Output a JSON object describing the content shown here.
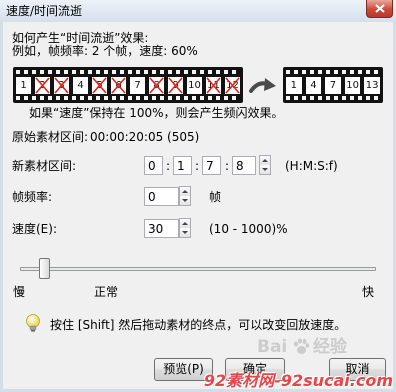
{
  "window": {
    "title": "速度/时间流逝"
  },
  "intro": {
    "heading": "如何产生“时间流逝”效果:",
    "example": "例如，帧频率: 2 个帧，速度: 60%"
  },
  "illustration": {
    "source_frames": [
      {
        "number": "1",
        "removed": false
      },
      {
        "number": "2",
        "removed": true
      },
      {
        "number": "3",
        "removed": true
      },
      {
        "number": "4",
        "removed": false
      },
      {
        "number": "5",
        "removed": true
      },
      {
        "number": "6",
        "removed": true
      },
      {
        "number": "7",
        "removed": false
      },
      {
        "number": "8",
        "removed": true
      },
      {
        "number": "9",
        "removed": true
      },
      {
        "number": "10",
        "removed": false
      },
      {
        "number": "11",
        "removed": true
      },
      {
        "number": "12",
        "removed": true
      }
    ],
    "result_frames": [
      "1",
      "4",
      "7",
      "10",
      "13"
    ]
  },
  "strobe_note": "如果“速度”保持在 100%，则会产生频闪效果。",
  "original_duration": {
    "label": "原始素材区间:",
    "value": "00:00:20:05 (505)"
  },
  "new_duration": {
    "label": "新素材区间:",
    "hours": "0",
    "minutes": "1",
    "seconds": "7",
    "frames": "8",
    "separator": ":",
    "format": "(H:M:S:f)"
  },
  "frame_rate": {
    "label": "帧频率:",
    "value": "0",
    "unit": "帧"
  },
  "speed": {
    "label": "速度(E):",
    "value": "30",
    "range": "(10 - 1000)%"
  },
  "speed_slider": {
    "level": 0.07,
    "slow_label": "慢",
    "normal_label": "正常",
    "fast_label": "快"
  },
  "tip": {
    "icon": "lightbulb-icon",
    "text": "按住 [Shift] 然后拖动素材的终点，可以改变回放速度。"
  },
  "buttons": {
    "preview": "预览(P)",
    "ok": "确定",
    "cancel": "取消"
  },
  "watermarks": {
    "site": "92素材网-92sucai.com",
    "baidu_left": "Bai",
    "baidu_right": "经验"
  },
  "colors": {
    "cross_mark": "#e3261f",
    "close_button": "#cb4a3c",
    "site_watermark": "#e2474b",
    "filmstrip": "#121212"
  }
}
